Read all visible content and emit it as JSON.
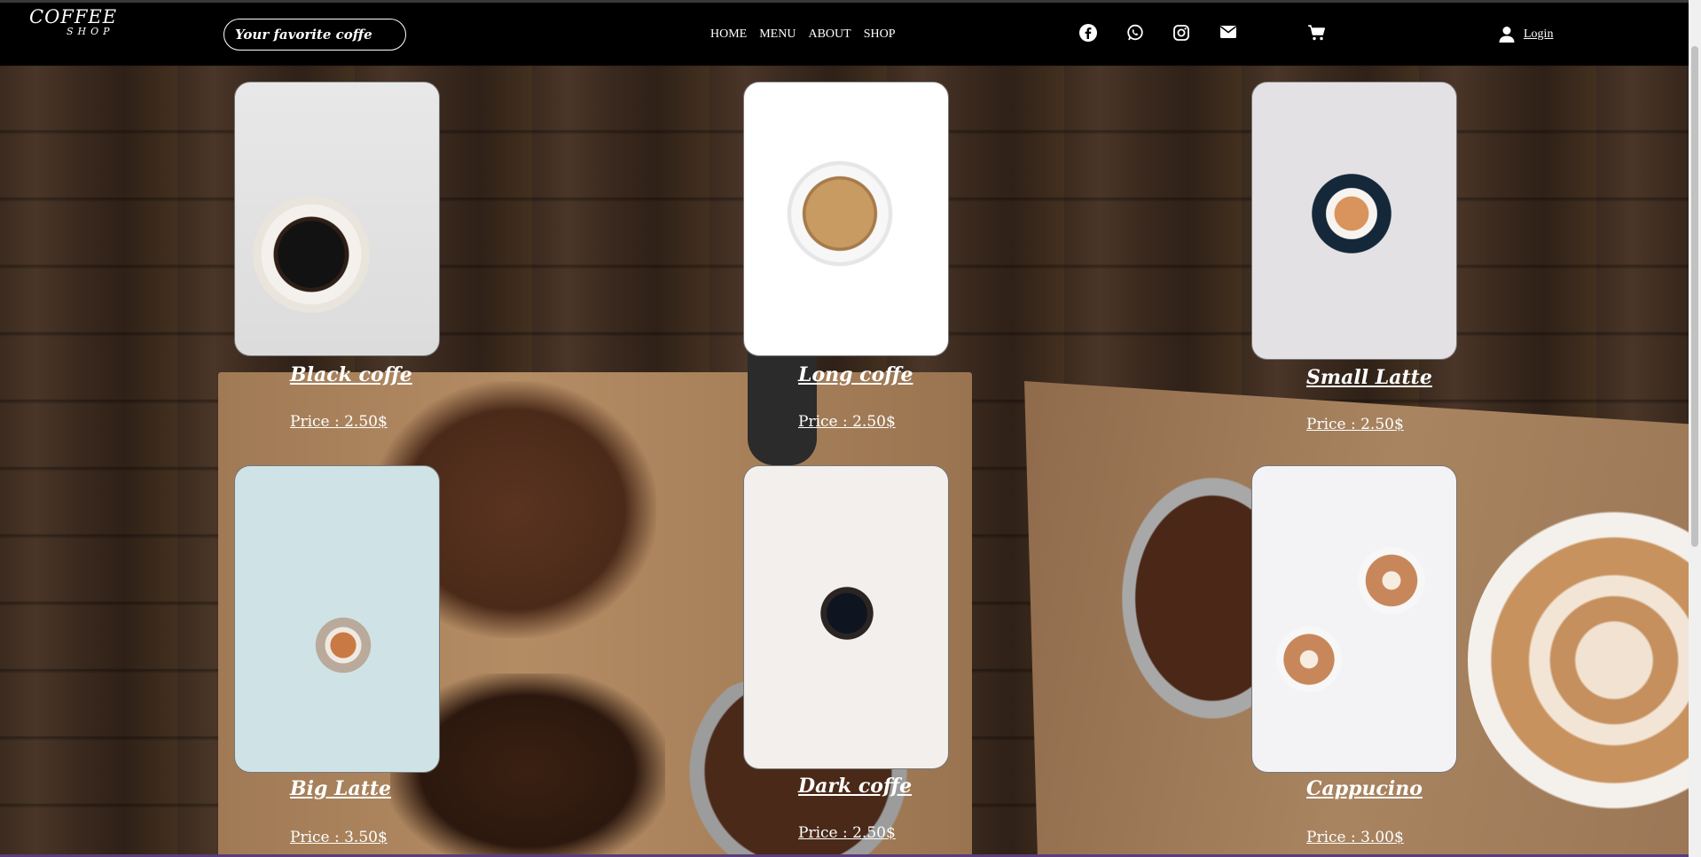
{
  "header": {
    "logo_line1": "COFFEE",
    "logo_line2": "SHOP",
    "search_placeholder": "Your favorite coffe",
    "nav": [
      "HOME",
      "MENU",
      "ABOUT",
      "SHOP"
    ],
    "social_icons": [
      "facebook-icon",
      "whatsapp-icon",
      "instagram-icon",
      "mail-icon"
    ],
    "cart_icon": "cart-icon",
    "user_icon": "user-icon",
    "login_label": "Login"
  },
  "products": [
    {
      "name": "Black coffe",
      "price": "Price : 2.50$"
    },
    {
      "name": "Long coffe",
      "price": "Price : 2.50$"
    },
    {
      "name": "Small Latte",
      "price": "Price : 2.50$"
    },
    {
      "name": "Big Latte",
      "price": "Price : 3.50$"
    },
    {
      "name": "Dark coffe",
      "price": "Price : 2.50$"
    },
    {
      "name": "Cappucino",
      "price": "Price : 3.00$"
    }
  ]
}
